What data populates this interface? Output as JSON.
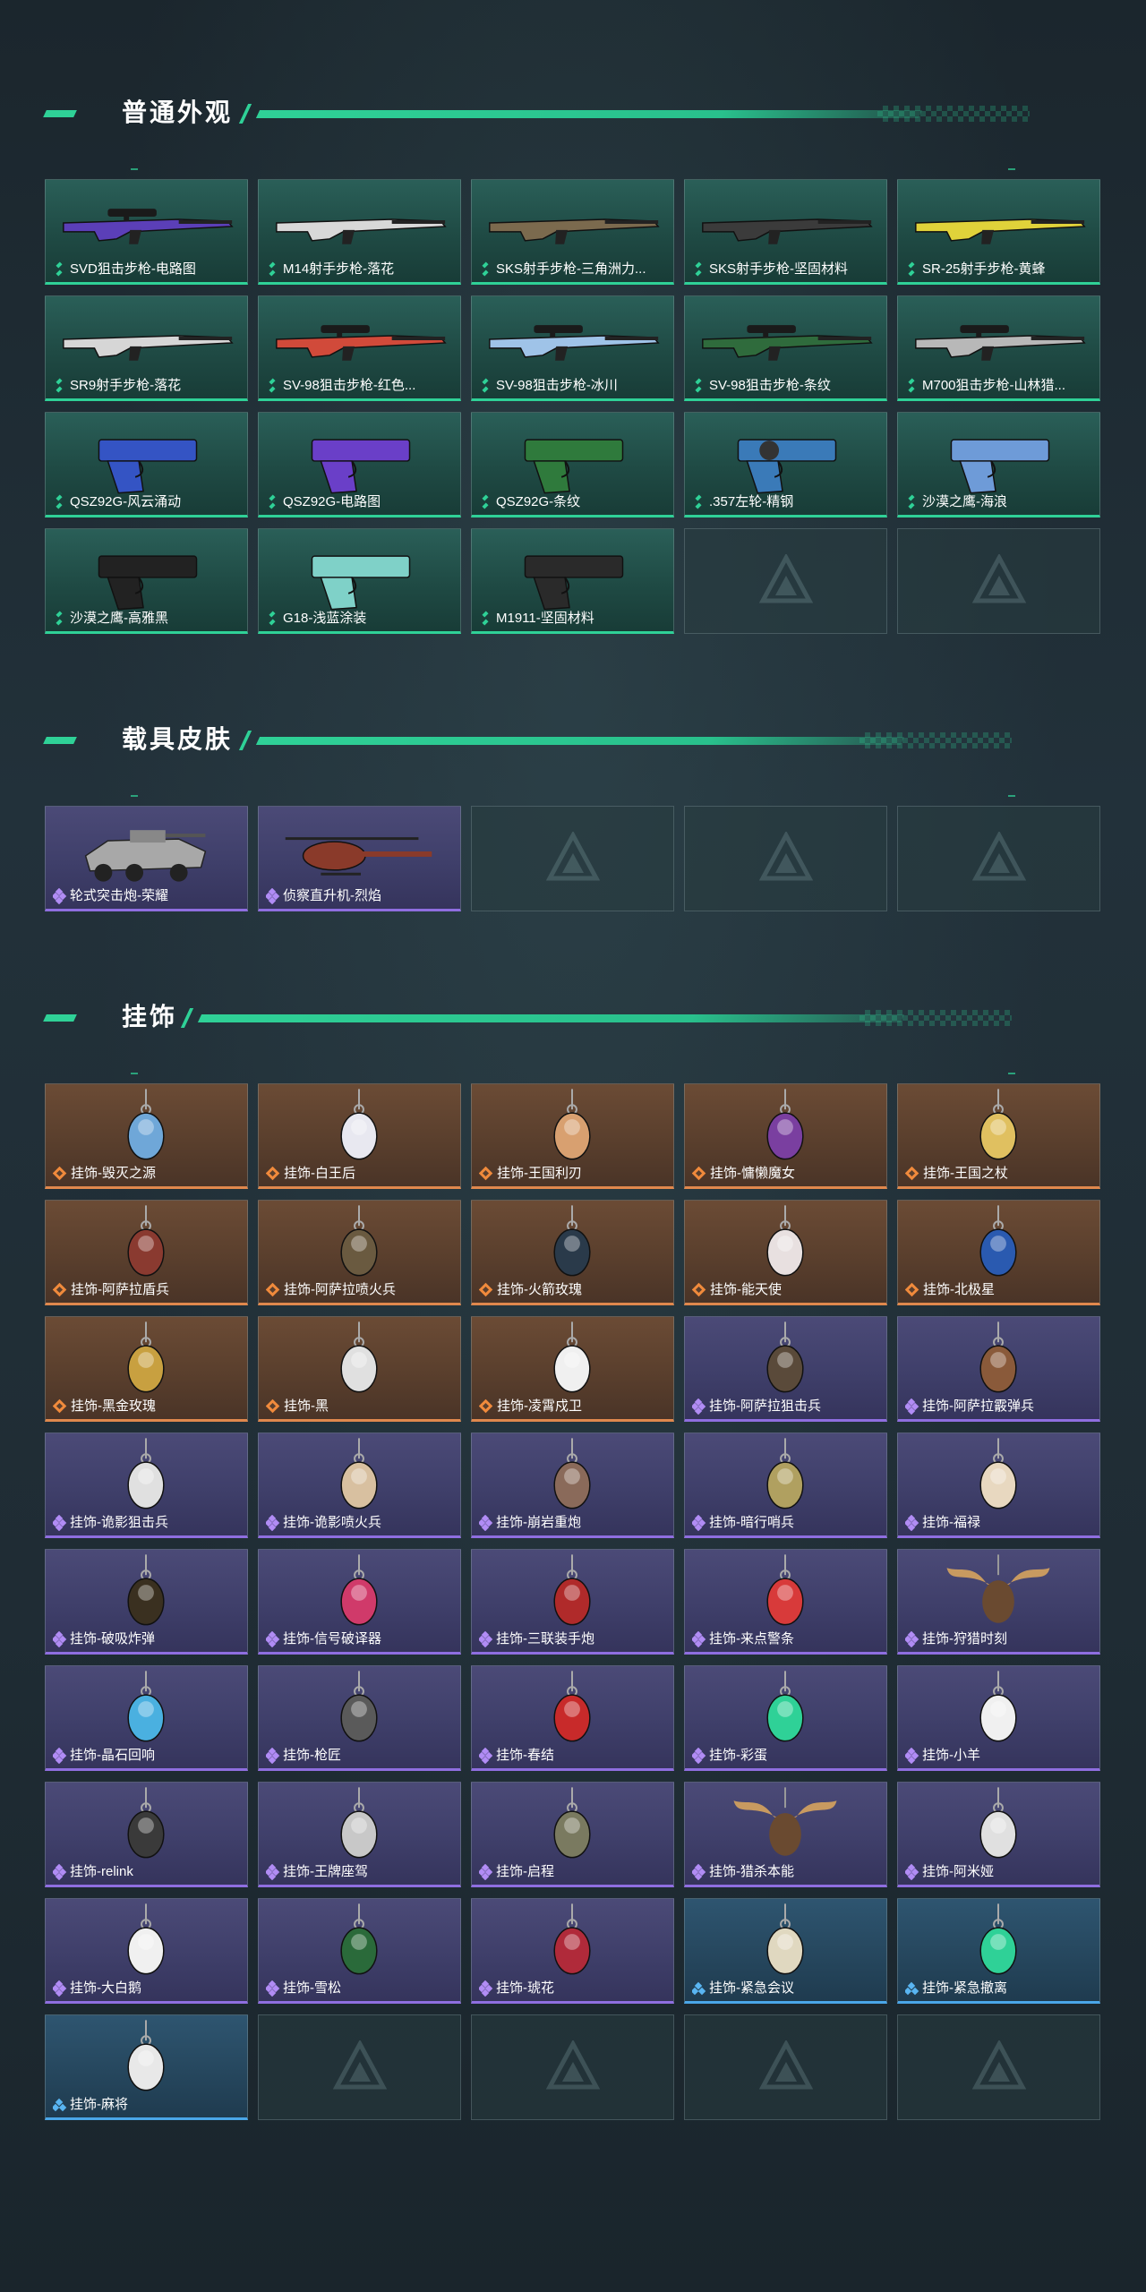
{
  "sections": [
    {
      "title": "普通外观",
      "items": [
        {
          "label": "SVD狙击步枪-电路图",
          "rarity": "green",
          "icon": "sniper-rifle-icon",
          "color": "#5b3fb8"
        },
        {
          "label": "M14射手步枪-落花",
          "rarity": "green",
          "icon": "rifle-icon",
          "color": "#d8d8d8"
        },
        {
          "label": "SKS射手步枪-三角洲力...",
          "rarity": "green",
          "icon": "rifle-icon",
          "color": "#7b6a4e"
        },
        {
          "label": "SKS射手步枪-坚固材料",
          "rarity": "green",
          "icon": "rifle-icon",
          "color": "#3b3b3b"
        },
        {
          "label": "SR-25射手步枪-黄蜂",
          "rarity": "green",
          "icon": "rifle-icon",
          "color": "#e0d23a"
        },
        {
          "label": "SR9射手步枪-落花",
          "rarity": "green",
          "icon": "rifle-icon",
          "color": "#d6d6d6"
        },
        {
          "label": "SV-98狙击步枪-红色...",
          "rarity": "green",
          "icon": "sniper-rifle-icon",
          "color": "#d14a3a"
        },
        {
          "label": "SV-98狙击步枪-冰川",
          "rarity": "green",
          "icon": "sniper-rifle-icon",
          "color": "#9fc3e8"
        },
        {
          "label": "SV-98狙击步枪-条纹",
          "rarity": "green",
          "icon": "sniper-rifle-icon",
          "color": "#2f6b3c"
        },
        {
          "label": "M700狙击步枪-山林猎...",
          "rarity": "green",
          "icon": "sniper-rifle-icon",
          "color": "#b8b8b8"
        },
        {
          "label": "QSZ92G-风云涌动",
          "rarity": "green",
          "icon": "pistol-icon",
          "color": "#3454c4"
        },
        {
          "label": "QSZ92G-电路图",
          "rarity": "green",
          "icon": "pistol-icon",
          "color": "#6a3fc8"
        },
        {
          "label": "QSZ92G-条纹",
          "rarity": "green",
          "icon": "pistol-icon",
          "color": "#2f7a3c"
        },
        {
          "label": ".357左轮-精钢",
          "rarity": "green",
          "icon": "revolver-icon",
          "color": "#3a7ab8"
        },
        {
          "label": "沙漠之鹰-海浪",
          "rarity": "green",
          "icon": "pistol-icon",
          "color": "#6e9bd8"
        },
        {
          "label": "沙漠之鹰-高雅黑",
          "rarity": "green",
          "icon": "pistol-icon",
          "color": "#222222"
        },
        {
          "label": "G18-浅蓝涂装",
          "rarity": "green",
          "icon": "pistol-icon",
          "color": "#7fd1c8"
        },
        {
          "label": "M1911-坚固材料",
          "rarity": "green",
          "icon": "pistol-icon",
          "color": "#2a2a2a"
        },
        {
          "label": "",
          "rarity": "empty"
        },
        {
          "label": "",
          "rarity": "empty"
        }
      ]
    },
    {
      "title": "载具皮肤",
      "items": [
        {
          "label": "轮式突击炮-荣耀",
          "rarity": "purple",
          "icon": "armored-vehicle-icon",
          "color": "#a8a8a8"
        },
        {
          "label": "侦察直升机-烈焰",
          "rarity": "purple",
          "icon": "helicopter-icon",
          "color": "#8a3a2a"
        },
        {
          "label": "",
          "rarity": "empty"
        },
        {
          "label": "",
          "rarity": "empty"
        },
        {
          "label": "",
          "rarity": "empty"
        }
      ]
    },
    {
      "title": "挂饰",
      "items": [
        {
          "label": "挂饰-毁灭之源",
          "rarity": "orange",
          "icon": "dragon-charm-icon",
          "color": "#6fa7d8"
        },
        {
          "label": "挂饰-白王后",
          "rarity": "orange",
          "icon": "queen-charm-icon",
          "color": "#e8e8f0"
        },
        {
          "label": "挂饰-王国利刃",
          "rarity": "orange",
          "icon": "knight-charm-icon",
          "color": "#d8a070"
        },
        {
          "label": "挂饰-慵懒魔女",
          "rarity": "orange",
          "icon": "witch-charm-icon",
          "color": "#7a3fa0"
        },
        {
          "label": "挂饰-王国之杖",
          "rarity": "orange",
          "icon": "king-charm-icon",
          "color": "#e0c060"
        },
        {
          "label": "挂饰-阿萨拉盾兵",
          "rarity": "orange",
          "icon": "soldier-charm-icon",
          "color": "#8a3a30"
        },
        {
          "label": "挂饰-阿萨拉喷火兵",
          "rarity": "orange",
          "icon": "soldier-charm-icon",
          "color": "#6a5a40"
        },
        {
          "label": "挂饰-火箭玫瑰",
          "rarity": "orange",
          "icon": "soldier-charm-icon",
          "color": "#2a3a4a"
        },
        {
          "label": "挂饰-能天使",
          "rarity": "orange",
          "icon": "tag-charm-icon",
          "color": "#e8e0e0"
        },
        {
          "label": "挂饰-北极星",
          "rarity": "orange",
          "icon": "key-charm-icon",
          "color": "#2a5ab0"
        },
        {
          "label": "挂饰-黑金玫瑰",
          "rarity": "orange",
          "icon": "emblem-charm-icon",
          "color": "#c8a040"
        },
        {
          "label": "挂饰-黑",
          "rarity": "orange",
          "icon": "tag-charm-icon",
          "color": "#e0e0e0"
        },
        {
          "label": "挂饰-凌霄戍卫",
          "rarity": "orange",
          "icon": "chick-charm-icon",
          "color": "#f0f0f0"
        },
        {
          "label": "挂饰-阿萨拉狙击兵",
          "rarity": "purple",
          "icon": "soldier-charm-icon",
          "color": "#5a4a3a"
        },
        {
          "label": "挂饰-阿萨拉霰弹兵",
          "rarity": "purple",
          "icon": "soldier-charm-icon",
          "color": "#8a5a3a"
        },
        {
          "label": "挂饰-诡影狙击兵",
          "rarity": "purple",
          "icon": "soldier-charm-icon",
          "color": "#e0e0e0"
        },
        {
          "label": "挂饰-诡影喷火兵",
          "rarity": "purple",
          "icon": "soldier-charm-icon",
          "color": "#d8c0a0"
        },
        {
          "label": "挂饰-崩岩重炮",
          "rarity": "purple",
          "icon": "soldier-charm-icon",
          "color": "#8a6a5a"
        },
        {
          "label": "挂饰-暗行哨兵",
          "rarity": "purple",
          "icon": "soldier-charm-icon",
          "color": "#b0a060"
        },
        {
          "label": "挂饰-福禄",
          "rarity": "purple",
          "icon": "gourd-charm-icon",
          "color": "#e8d8c0"
        },
        {
          "label": "挂饰-破吸炸弹",
          "rarity": "purple",
          "icon": "bomb-charm-icon",
          "color": "#3a3020"
        },
        {
          "label": "挂饰-信号破译器",
          "rarity": "purple",
          "icon": "device-charm-icon",
          "color": "#d03a6a"
        },
        {
          "label": "挂饰-三联装手炮",
          "rarity": "purple",
          "icon": "launcher-charm-icon",
          "color": "#b02a2a"
        },
        {
          "label": "挂饰-来点警条",
          "rarity": "purple",
          "icon": "candy-charm-icon",
          "color": "#d83a3a"
        },
        {
          "label": "挂饰-狩猎时刻",
          "rarity": "purple",
          "icon": "antler-charm-icon",
          "color": "#c89a60"
        },
        {
          "label": "挂饰-晶石回响",
          "rarity": "purple",
          "icon": "crystal-charm-icon",
          "color": "#4ab0e0"
        },
        {
          "label": "挂饰-枪匠",
          "rarity": "purple",
          "icon": "badge-charm-icon",
          "color": "#5a5a5a"
        },
        {
          "label": "挂饰-春结",
          "rarity": "purple",
          "icon": "knot-charm-icon",
          "color": "#c82a2a"
        },
        {
          "label": "挂饰-彩蛋",
          "rarity": "purple",
          "icon": "triangle-charm-icon",
          "color": "#2fd197"
        },
        {
          "label": "挂饰-小羊",
          "rarity": "purple",
          "icon": "sheep-charm-icon",
          "color": "#f0f0f0"
        },
        {
          "label": "挂饰-relink",
          "rarity": "purple",
          "icon": "shield-charm-icon",
          "color": "#3a3a3a"
        },
        {
          "label": "挂饰-王牌座驾",
          "rarity": "purple",
          "icon": "plane-charm-icon",
          "color": "#c8c8c8"
        },
        {
          "label": "挂饰-启程",
          "rarity": "purple",
          "icon": "emblem-charm-icon",
          "color": "#7a7a60"
        },
        {
          "label": "挂饰-猎杀本能",
          "rarity": "purple",
          "icon": "antler-charm-icon",
          "color": "#c89a60"
        },
        {
          "label": "挂饰-阿米娅",
          "rarity": "purple",
          "icon": "bunny-charm-icon",
          "color": "#e0e0e0"
        },
        {
          "label": "挂饰-大白鹅",
          "rarity": "purple",
          "icon": "goose-charm-icon",
          "color": "#f0f0f0"
        },
        {
          "label": "挂饰-雪松",
          "rarity": "purple",
          "icon": "tree-charm-icon",
          "color": "#2a6a3a"
        },
        {
          "label": "挂饰-琥花",
          "rarity": "purple",
          "icon": "flower-charm-icon",
          "color": "#b02a3a"
        },
        {
          "label": "挂饰-紧急会议",
          "rarity": "blue",
          "icon": "frame-charm-icon",
          "color": "#e0d8c0"
        },
        {
          "label": "挂饰-紧急撤离",
          "rarity": "blue",
          "icon": "frame-charm-icon",
          "color": "#2fd197"
        },
        {
          "label": "挂饰-麻将",
          "rarity": "blue",
          "icon": "mahjong-charm-icon",
          "color": "#e8e8e8"
        },
        {
          "label": "",
          "rarity": "empty"
        },
        {
          "label": "",
          "rarity": "empty"
        },
        {
          "label": "",
          "rarity": "empty"
        },
        {
          "label": "",
          "rarity": "empty"
        }
      ]
    }
  ]
}
